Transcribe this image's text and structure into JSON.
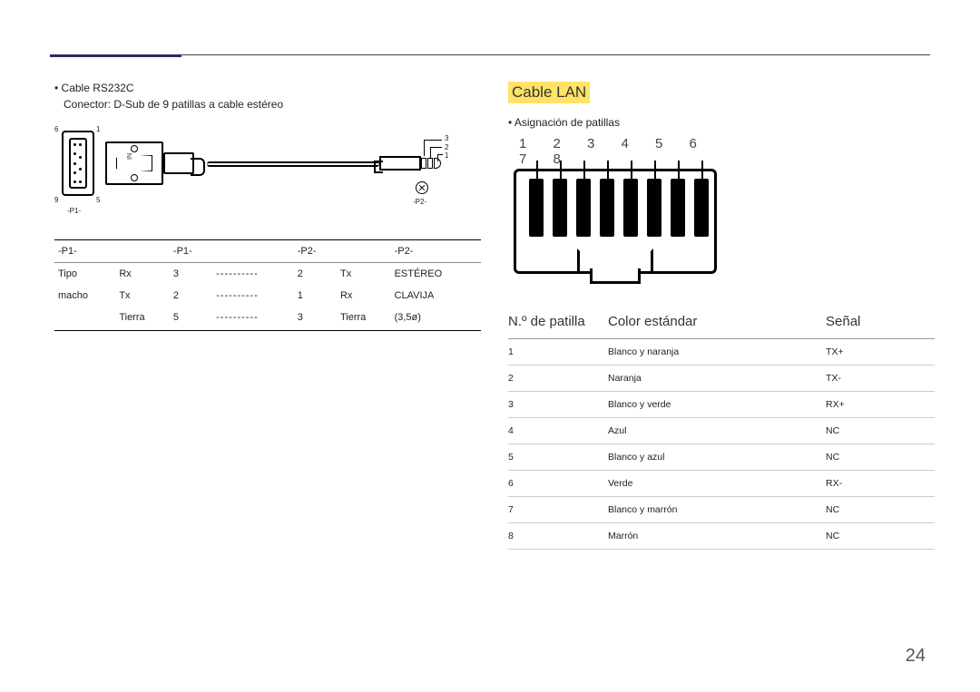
{
  "left": {
    "bullet": "Cable RS232C",
    "subline": "Conector: D-Sub de 9 patillas a cable estéreo",
    "fig": {
      "l6": "6",
      "l1": "1",
      "l9": "9",
      "l5": "5",
      "in": "IN",
      "p1": "-P1-",
      "p2": "-P2-",
      "j3": "3",
      "j2": "2",
      "j1": "1"
    },
    "tbl": {
      "h": [
        "-P1-",
        "-P1-",
        "",
        "",
        "-P2-",
        "",
        "-P2-"
      ],
      "rowlabel1": "Tipo",
      "rowlabel2": "macho",
      "r1": [
        "Rx",
        "3",
        "----------",
        "2",
        "Tx",
        "ESTÉREO"
      ],
      "r2": [
        "Tx",
        "2",
        "----------",
        "1",
        "Rx",
        "CLAVIJA"
      ],
      "r3": [
        "Tierra",
        "5",
        "----------",
        "3",
        "Tierra",
        "(3,5ø)"
      ]
    }
  },
  "right": {
    "title": "Cable LAN",
    "bullet": "Asignación de patillas",
    "nums": "1 2 3 4 5 6 7 8",
    "headers": {
      "c1": "N.º de patilla",
      "c2": "Color estándar",
      "c3": "Señal"
    },
    "rows": [
      {
        "n": "1",
        "c": "Blanco y naranja",
        "s": "TX+"
      },
      {
        "n": "2",
        "c": "Naranja",
        "s": "TX-"
      },
      {
        "n": "3",
        "c": "Blanco y verde",
        "s": "RX+"
      },
      {
        "n": "4",
        "c": "Azul",
        "s": "NC"
      },
      {
        "n": "5",
        "c": "Blanco y azul",
        "s": "NC"
      },
      {
        "n": "6",
        "c": "Verde",
        "s": "RX-"
      },
      {
        "n": "7",
        "c": "Blanco y marrón",
        "s": "NC"
      },
      {
        "n": "8",
        "c": "Marrón",
        "s": "NC"
      }
    ]
  },
  "page": "24"
}
